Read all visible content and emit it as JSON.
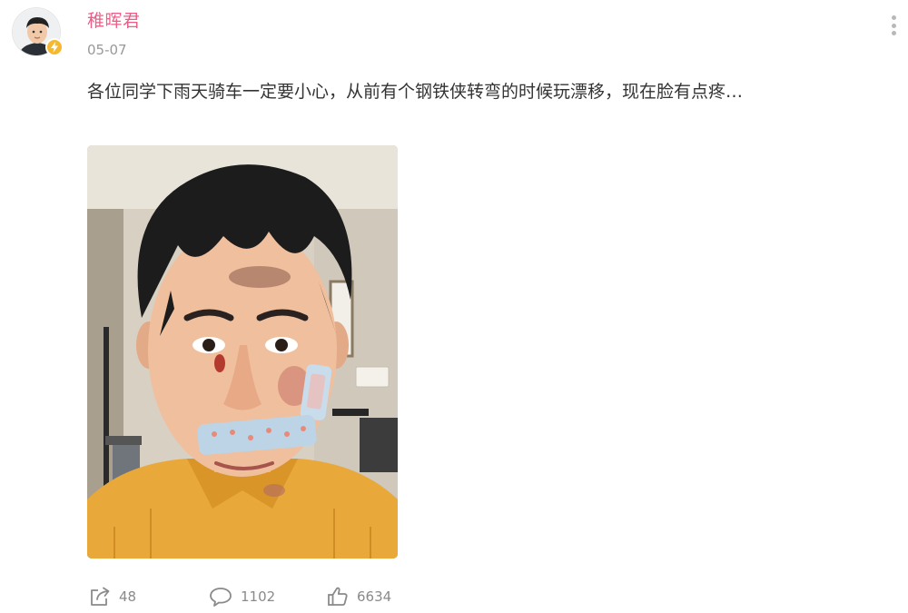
{
  "user": {
    "name": "稚晖君",
    "avatar_icon": "user-avatar",
    "badge_icon": "lightning-icon",
    "badge_color": "#f5b82e"
  },
  "post": {
    "date": "05-07",
    "text": "各位同学下雨天骑车一定要小心，从前有个钢铁侠转弯的时候玩漂移，现在脸有点疼…",
    "image_icon": "selfie-photo"
  },
  "actions": {
    "share": {
      "icon": "share-icon",
      "count": "48"
    },
    "comment": {
      "icon": "comment-icon",
      "count": "1102"
    },
    "like": {
      "icon": "thumbs-up-icon",
      "count": "6634"
    }
  },
  "menu": {
    "icon": "more-options-icon"
  },
  "colors": {
    "username": "#eb5e87",
    "meta": "#999999",
    "text": "#333333",
    "action": "#8a8a8a"
  }
}
